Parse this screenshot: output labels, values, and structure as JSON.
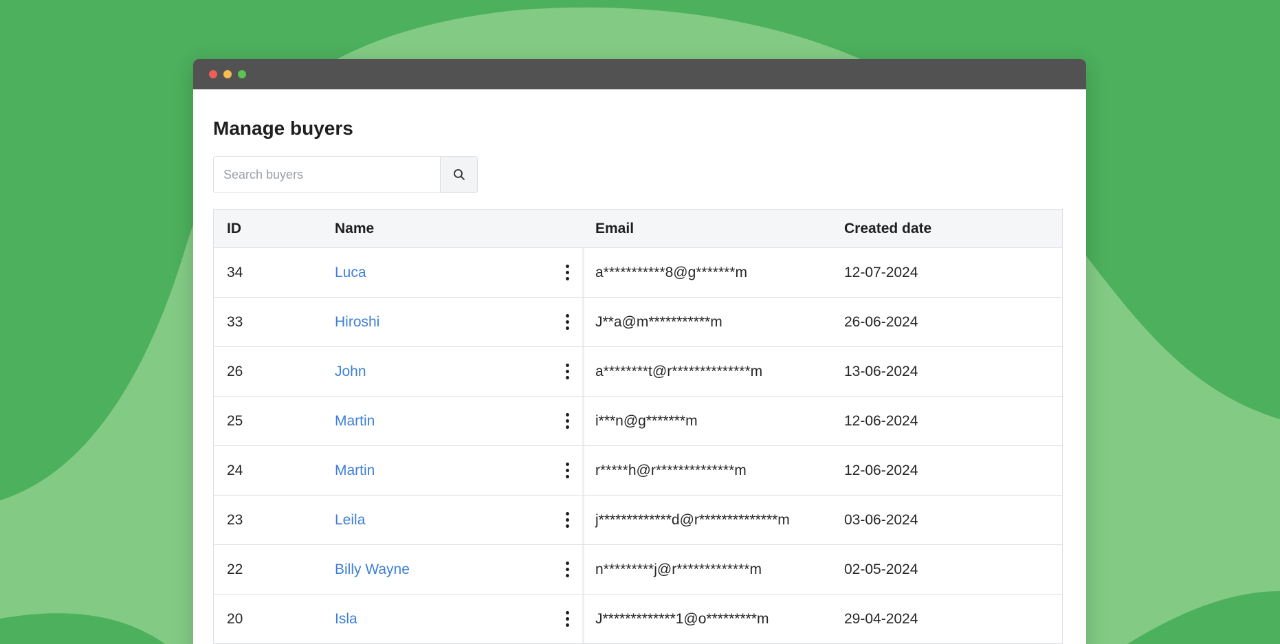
{
  "window": {
    "buttons": [
      "close",
      "minimize",
      "maximize"
    ]
  },
  "page": {
    "title": "Manage buyers"
  },
  "search": {
    "placeholder": "Search buyers",
    "icon": "search-icon"
  },
  "table": {
    "columns": {
      "id": "ID",
      "name": "Name",
      "email": "Email",
      "created": "Created date"
    },
    "rows": [
      {
        "id": "34",
        "name": "Luca",
        "email": "a***********8@g*******m",
        "created": "12-07-2024"
      },
      {
        "id": "33",
        "name": "Hiroshi",
        "email": "J**a@m***********m",
        "created": "26-06-2024"
      },
      {
        "id": "26",
        "name": "John",
        "email": "a********t@r**************m",
        "created": "13-06-2024"
      },
      {
        "id": "25",
        "name": "Martin",
        "email": "i***n@g*******m",
        "created": "12-06-2024"
      },
      {
        "id": "24",
        "name": "Martin",
        "email": "r*****h@r**************m",
        "created": "12-06-2024"
      },
      {
        "id": "23",
        "name": "Leila",
        "email": "j*************d@r**************m",
        "created": "03-06-2024"
      },
      {
        "id": "22",
        "name": "Billy Wayne",
        "email": "n*********j@r*************m",
        "created": "02-05-2024"
      },
      {
        "id": "20",
        "name": "Isla",
        "email": "J*************1@o*********m",
        "created": "29-04-2024"
      }
    ]
  },
  "colors": {
    "background": "#4cb05c",
    "background_light": "#83cb85",
    "titlebar": "#525252",
    "link": "#3d7fd6"
  }
}
